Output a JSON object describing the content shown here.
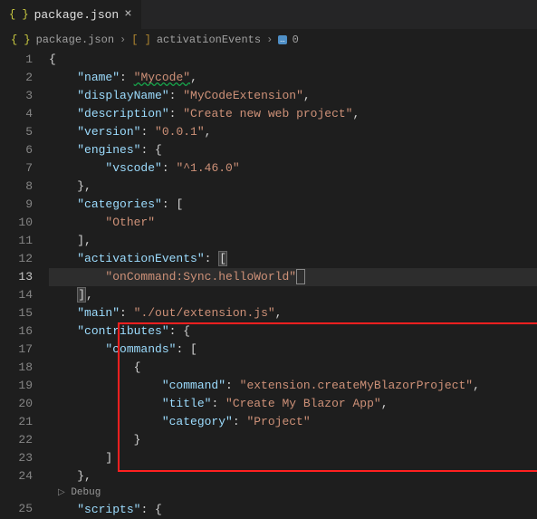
{
  "tab": {
    "filename": "package.json",
    "close": "×"
  },
  "breadcrumb": {
    "filename": "package.json",
    "path1": "activationEvents",
    "path2": "0"
  },
  "gutter": [
    "1",
    "2",
    "3",
    "4",
    "5",
    "6",
    "7",
    "8",
    "9",
    "10",
    "11",
    "12",
    "13",
    "14",
    "15",
    "16",
    "17",
    "18",
    "19",
    "20",
    "21",
    "22",
    "23",
    "24",
    "25"
  ],
  "keys": {
    "name": "\"name\"",
    "displayName": "\"displayName\"",
    "description": "\"description\"",
    "version": "\"version\"",
    "engines": "\"engines\"",
    "vscode": "\"vscode\"",
    "categories": "\"categories\"",
    "activationEvents": "\"activationEvents\"",
    "main": "\"main\"",
    "contributes": "\"contributes\"",
    "commands": "\"commands\"",
    "command": "\"command\"",
    "title": "\"title\"",
    "category": "\"category\"",
    "scripts": "\"scripts\""
  },
  "vals": {
    "name": "\"Mycode\"",
    "displayName": "\"MyCodeExtension\"",
    "description": "\"Create new web project\"",
    "version": "\"0.0.1\"",
    "vscode": "\"^1.46.0\"",
    "other": "\"Other\"",
    "onCommand": "\"onCommand:Sync.helloWorld\"",
    "main": "\"./out/extension.js\"",
    "command": "\"extension.createMyBlazorProject\"",
    "title": "\"Create My Blazor App\"",
    "category": "\"Project\""
  },
  "codelens": {
    "debug": "Debug"
  }
}
